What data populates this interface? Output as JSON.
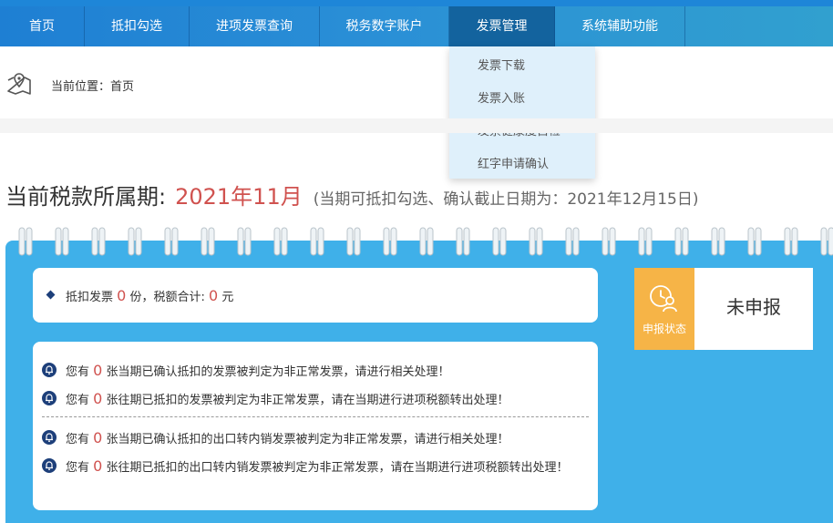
{
  "nav": {
    "items": [
      {
        "label": "首页"
      },
      {
        "label": "抵扣勾选"
      },
      {
        "label": "进项发票查询"
      },
      {
        "label": "税务数字账户"
      },
      {
        "label": "发票管理"
      },
      {
        "label": "系统辅助功能"
      }
    ],
    "active_index": 4
  },
  "dropdown": {
    "items": [
      {
        "label": "发票下载"
      },
      {
        "label": "发票入账"
      },
      {
        "label": "发票健康度自检"
      },
      {
        "label": "红字申请确认"
      }
    ]
  },
  "breadcrumb": {
    "icon": "map-location-icon",
    "text": "当前位置：首页"
  },
  "period": {
    "label": "当前税款所属期:",
    "value": "2021年11月",
    "note": "(当期可抵扣勾选、确认截止日期为：2021年12月15日)"
  },
  "summary": {
    "prefix": "抵扣发票",
    "count": "0",
    "middle": "份，税额合计:",
    "amount": "0",
    "suffix": "元"
  },
  "status": {
    "icon": "clock-person-icon",
    "label": "申报状态",
    "value": "未申报"
  },
  "alerts": [
    {
      "prefix": "您有",
      "count": "0",
      "text": "张当期已确认抵扣的发票被判定为非正常发票，请进行相关处理！"
    },
    {
      "prefix": "您有",
      "count": "0",
      "text": "张往期已抵扣的发票被判定为非正常发票，请在当期进行进项税额转出处理！"
    },
    {
      "prefix": "您有",
      "count": "0",
      "text": "张当期已确认抵扣的出口转内销发票被判定为非正常发票，请进行相关处理！"
    },
    {
      "prefix": "您有",
      "count": "0",
      "text": "张往期已抵扣的出口转内销发票被判定为非正常发票，请在当期进行进项税额转出处理！"
    }
  ],
  "colors": {
    "nav_bg": "#1e7fd3",
    "nav_active": "#13639e",
    "panel_bg": "#3fb0e9",
    "accent_red": "#d0524f",
    "status_tag": "#f6b447",
    "dropdown_bg": "#dff0fb"
  }
}
